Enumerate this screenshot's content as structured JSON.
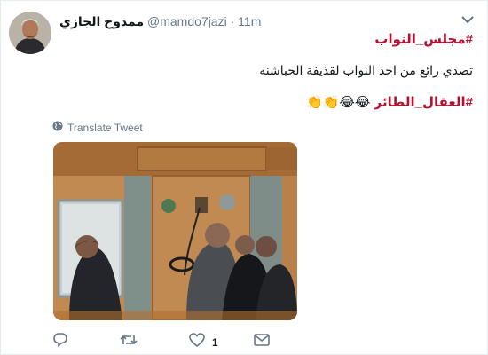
{
  "tweet": {
    "display_name": "ممدوح الجازي",
    "handle": "@mamdo7jazi",
    "separator": "·",
    "time": "11m",
    "hashtag_line": "#مجلس_النواب",
    "text_line": "تصدي رائع من احد النواب لقذيفة الحباشنه",
    "hashtag2": "#العقال_الطائر",
    "emoji": "😂😂👏👏",
    "translate_label": "Translate Tweet",
    "like_count": "1"
  },
  "icons": {
    "caret": "chevron-down-icon",
    "globe": "globe-icon",
    "reply": "reply-icon",
    "retweet": "retweet-icon",
    "like": "heart-icon",
    "dm": "envelope-icon"
  },
  "colors": {
    "hashtag": "#b5102f",
    "secondary_text": "#657786",
    "border": "#e6ecf0"
  }
}
